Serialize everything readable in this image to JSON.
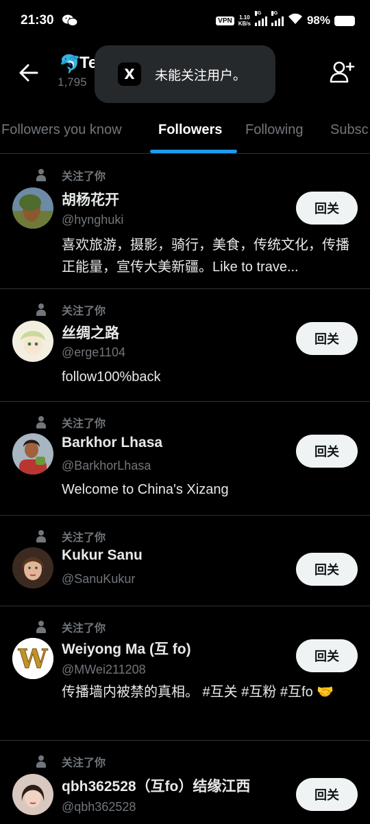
{
  "status_bar": {
    "time": "21:30",
    "vpn": "VPN",
    "net_speed_value": "1.10",
    "net_speed_unit": "KB/s",
    "signal1_label": "5G",
    "signal2_label": "5G",
    "battery": "98%"
  },
  "header": {
    "name": "Te",
    "count": "1,795"
  },
  "toast": {
    "logo": "X",
    "message": "未能关注用户。"
  },
  "tabs": [
    {
      "label": "Followers you know"
    },
    {
      "label": "Followers"
    },
    {
      "label": "Following"
    },
    {
      "label": "Subsc"
    }
  ],
  "users": [
    {
      "follows_you": "关注了你",
      "name": "胡杨花开",
      "handle": "@hynghuki",
      "bio": "喜欢旅游，摄影，骑行，美食，传统文化，传播正能量，宣传大美新疆。Like to trave...",
      "button": "回关"
    },
    {
      "follows_you": "关注了你",
      "name": "丝绸之路",
      "handle": "@erge1104",
      "bio": "follow100%back",
      "button": "回关"
    },
    {
      "follows_you": "关注了你",
      "name": "Barkhor Lhasa",
      "handle": "@BarkhorLhasa",
      "bio": "Welcome to China's Xizang",
      "button": "回关"
    },
    {
      "follows_you": "关注了你",
      "name": "Kukur Sanu",
      "handle": "@SanuKukur",
      "bio": "",
      "button": "回关"
    },
    {
      "follows_you": "关注了你",
      "name": "Weiyong Ma (互 fo)",
      "handle": "@MWei211208",
      "bio": "传播墙内被禁的真相。 #互关 #互粉 #互fo 🤝",
      "button": "回关"
    },
    {
      "follows_you": "关注了你",
      "name": "qbh362528（互fo）结缘江西",
      "handle": "@qbh362528",
      "bio": "",
      "button": "回关"
    }
  ]
}
